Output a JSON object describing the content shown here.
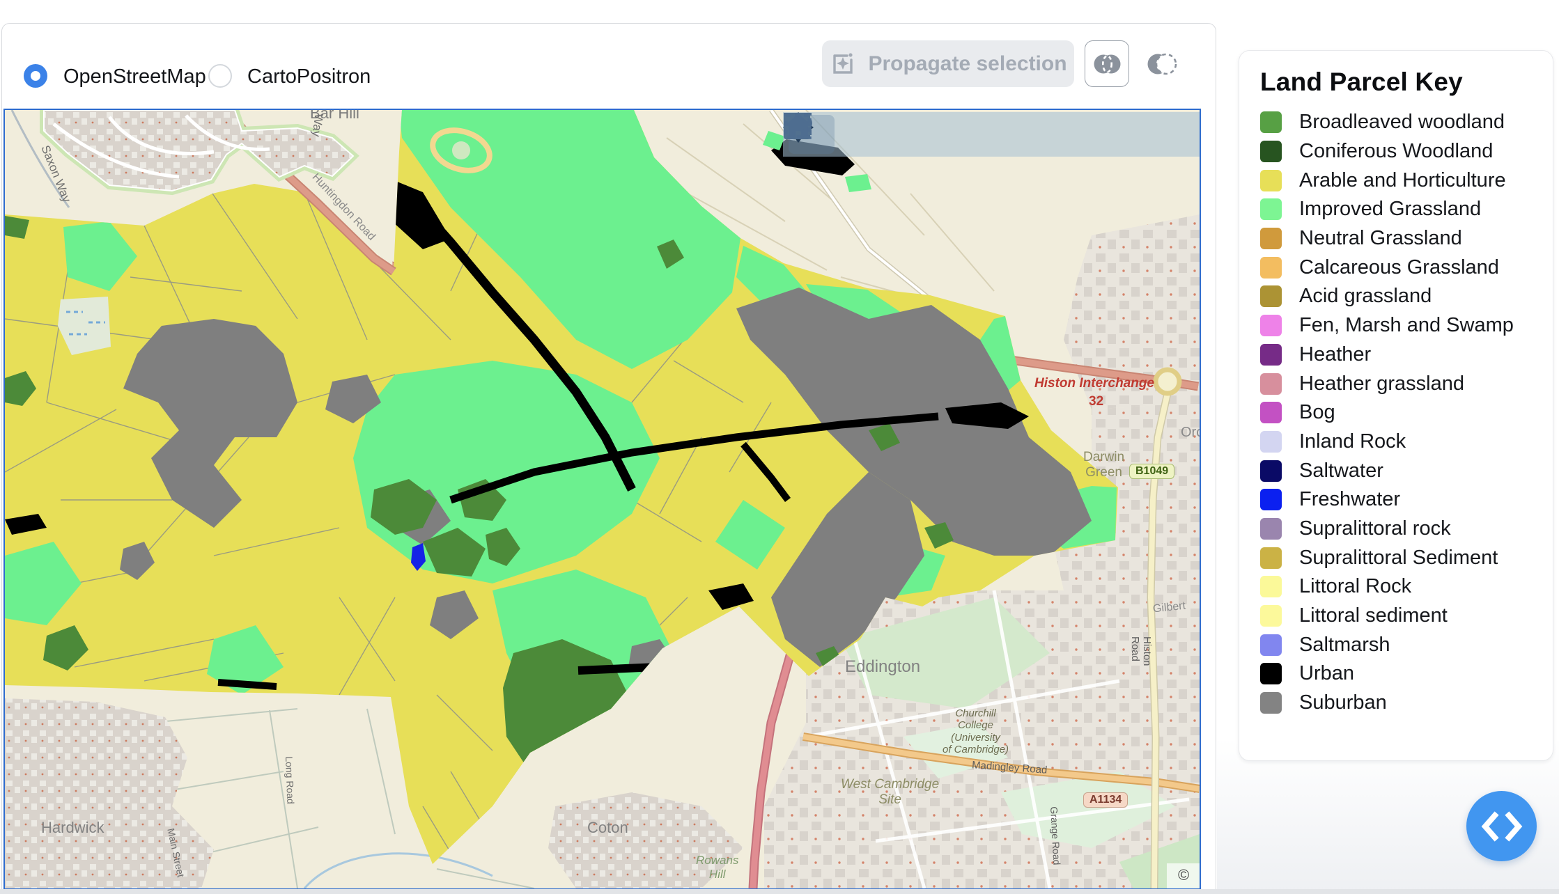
{
  "header": {
    "basemap_options": [
      {
        "label": "OpenStreetMap",
        "selected": true
      },
      {
        "label": "CartoPositron",
        "selected": false
      }
    ],
    "propagate_button": {
      "label": "Propagate selection",
      "enabled": false,
      "icon": "sparkle-frame-icon"
    },
    "mode_buttons": [
      {
        "name": "overlap-selection-mode",
        "icon": "overlap-circles-icon",
        "active": true
      },
      {
        "name": "difference-selection-mode",
        "icon": "difference-circles-icon",
        "active": false
      }
    ]
  },
  "map_toolbar": {
    "tools": [
      "camera",
      "pan",
      "box-select",
      "lasso-select",
      "zoom-in",
      "zoom-out",
      "reset-view",
      "clear-selection"
    ]
  },
  "map": {
    "border_color": "#2e6cce",
    "labels": {
      "bar_hill": "Bar Hill",
      "way": "Way",
      "saxon_way": "Saxon Way",
      "huntingdon_road": "Huntingdon Road",
      "histon_interchange": "Histon Interchange",
      "junction_number": "32",
      "b1049": "B1049",
      "darwin_green": "Darwin\nGreen",
      "orchard_park": "Orchar",
      "gilbert_road": "Gilbert",
      "eddington": "Eddington",
      "churchill_college": "Churchill\nCollege\n(University\nof Cambridge)",
      "west_cambridge": "West Cambridge\nSite",
      "madingley_road": "Madingley Road",
      "a1134": "A1134",
      "histon_road": "Histon Road",
      "grange_road": "Grange Road",
      "coton": "Coton",
      "rowans_hill": "Rowans\nHill",
      "hardwick": "Hardwick",
      "main_street": "Main Street",
      "long_road": "Long Road",
      "copyright": "©"
    },
    "overlay_colors": {
      "arable": "#e7df58",
      "improved_grassland": "#6cf08f",
      "woodland": "#4c8a39",
      "suburban": "#7f7f7f",
      "urban": "#000000",
      "freshwater": "#1523e6"
    }
  },
  "legend": {
    "title": "Land Parcel Key",
    "items": [
      {
        "label": "Broadleaved woodland",
        "color": "#57a044"
      },
      {
        "label": "Coniferous Woodland",
        "color": "#275420"
      },
      {
        "label": "Arable and Horticulture",
        "color": "#e7df58"
      },
      {
        "label": "Improved Grassland",
        "color": "#7df593"
      },
      {
        "label": "Neutral Grassland",
        "color": "#d09a3c"
      },
      {
        "label": "Calcareous Grassland",
        "color": "#f3bd60"
      },
      {
        "label": "Acid grassland",
        "color": "#ac9334"
      },
      {
        "label": "Fen, Marsh and Swamp",
        "color": "#ee82e8"
      },
      {
        "label": "Heather",
        "color": "#762b87"
      },
      {
        "label": "Heather grassland",
        "color": "#d78f9d"
      },
      {
        "label": "Bog",
        "color": "#c351c3"
      },
      {
        "label": "Inland Rock",
        "color": "#d3d5f1"
      },
      {
        "label": "Saltwater",
        "color": "#0a0a66"
      },
      {
        "label": "Freshwater",
        "color": "#0b20f0"
      },
      {
        "label": "Supralittoral rock",
        "color": "#9a85ae"
      },
      {
        "label": "Supralittoral Sediment",
        "color": "#cbb245"
      },
      {
        "label": "Littoral Rock",
        "color": "#fbf999"
      },
      {
        "label": "Littoral sediment",
        "color": "#fcf99b"
      },
      {
        "label": "Saltmarsh",
        "color": "#8186ef"
      },
      {
        "label": "Urban",
        "color": "#000000"
      },
      {
        "label": "Suburban",
        "color": "#838383"
      }
    ]
  },
  "fab": {
    "icon": "code-chevrons-icon"
  }
}
